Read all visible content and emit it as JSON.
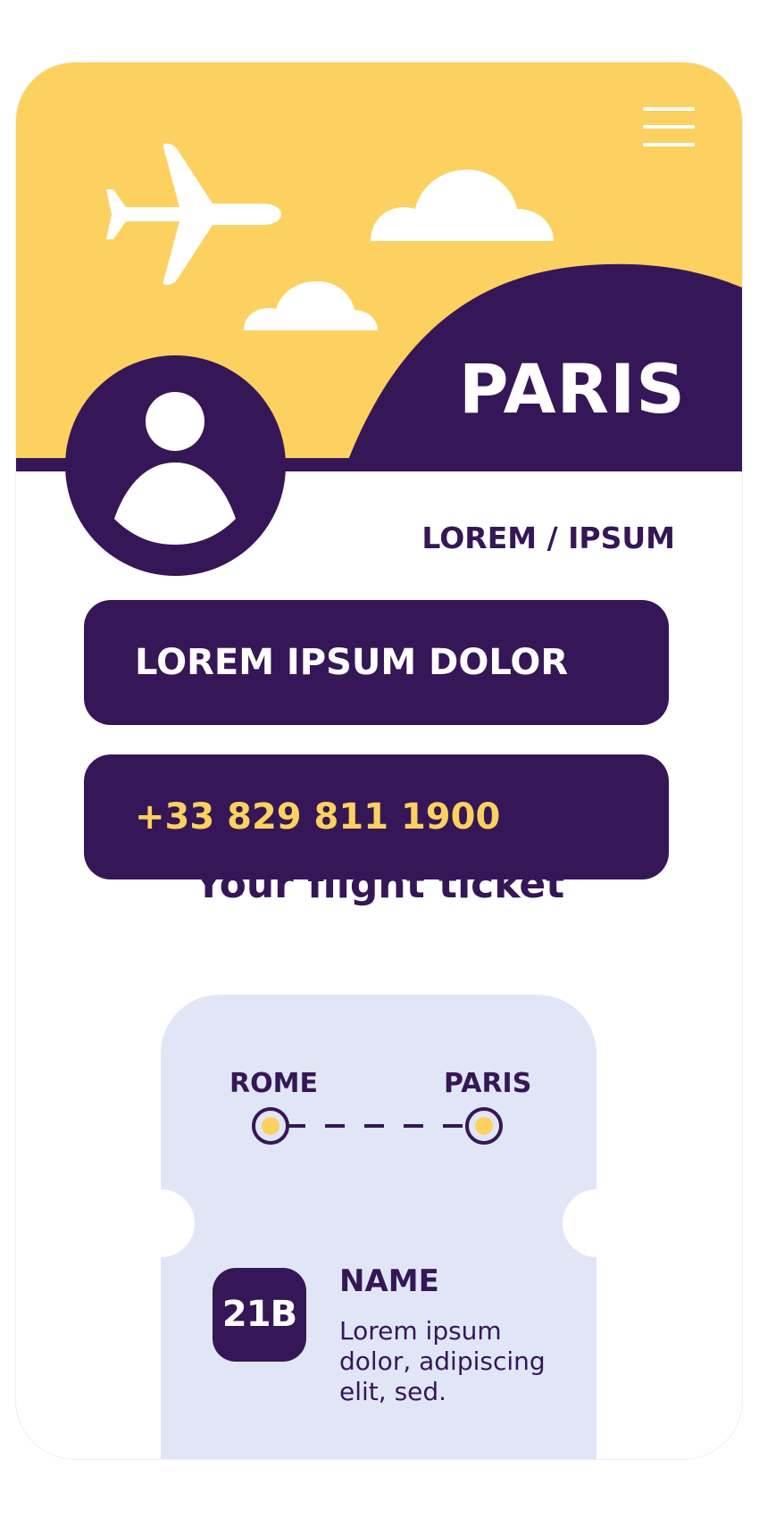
{
  "colors": {
    "accent_yellow": "#fcd15f",
    "primary_purple": "#351757",
    "ticket_bg": "#e1e6f7",
    "white": "#ffffff"
  },
  "header": {
    "city": "PARIS",
    "menu_icon": "hamburger-menu-icon",
    "plane_icon": "airplane-icon",
    "cloud_icon": "cloud-icon",
    "avatar_icon": "user-avatar-icon"
  },
  "profile": {
    "route_label": "LOREM / IPSUM",
    "name_field": "LOREM IPSUM DOLOR",
    "phone_field": "+33 829 811 1900"
  },
  "ticket": {
    "heading": "Your flight ticket",
    "from": "ROME",
    "to": "PARIS",
    "seat": "21B",
    "name_label": "NAME",
    "description": "Lorem ipsum dolor, adipiscing elit, sed."
  }
}
